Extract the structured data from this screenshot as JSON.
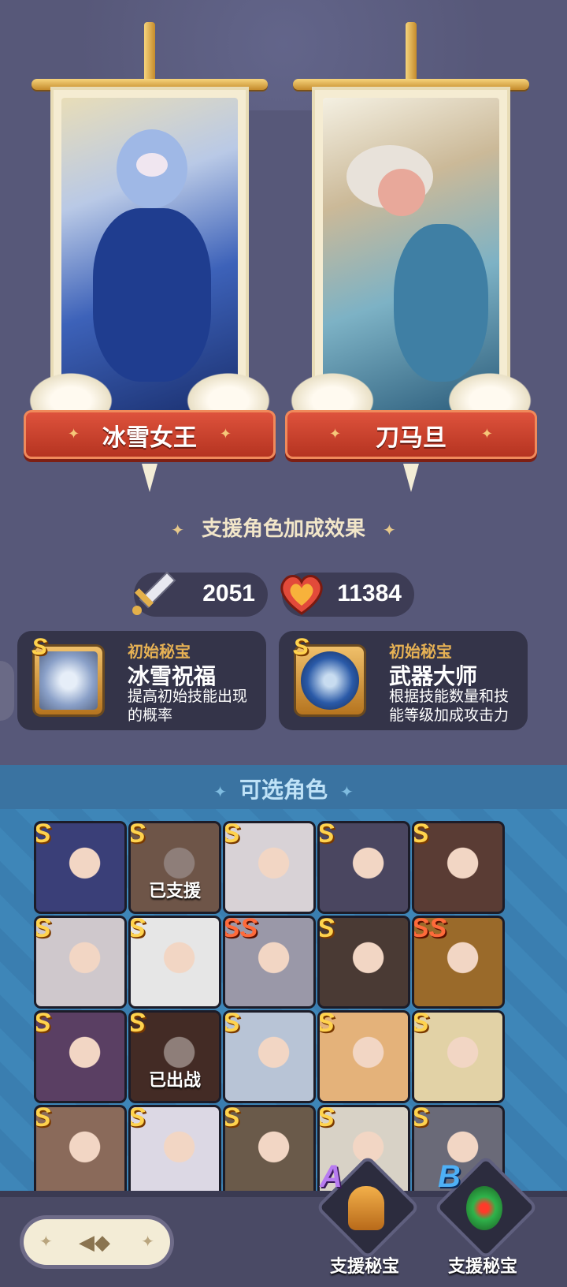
{
  "featured": [
    {
      "name": "冰雪女王",
      "theme": "ice"
    },
    {
      "name": "刀马旦",
      "theme": "opera"
    }
  ],
  "bonus": {
    "title": "支援角色加成效果",
    "attack": "2051",
    "hp": "11384"
  },
  "treasures": [
    {
      "grade": "S",
      "kind": "初始秘宝",
      "name": "冰雪祝福",
      "desc": "提高初始技能出现的概率"
    },
    {
      "grade": "S",
      "kind": "初始秘宝",
      "name": "武器大师",
      "desc": "根据技能数量和技能等级加成攻击力"
    }
  ],
  "selectable": {
    "title": "可选角色",
    "grid": [
      {
        "grade": "S",
        "status": "",
        "color": "#3a3f78"
      },
      {
        "grade": "S",
        "status": "已支援",
        "color": "#b88a6a"
      },
      {
        "grade": "S",
        "status": "",
        "color": "#d8d2d6"
      },
      {
        "grade": "S",
        "status": "",
        "color": "#4a4660"
      },
      {
        "grade": "S",
        "status": "",
        "color": "#5a3c34"
      },
      {
        "grade": "S",
        "status": "",
        "color": "#cfc8cc"
      },
      {
        "grade": "S",
        "status": "",
        "color": "#e6e6e6"
      },
      {
        "grade": "SS",
        "status": "",
        "color": "#9a98a8"
      },
      {
        "grade": "S",
        "status": "",
        "color": "#4a3a34"
      },
      {
        "grade": "SS",
        "status": "",
        "color": "#9a6a2a"
      },
      {
        "grade": "S",
        "status": "",
        "color": "#5a3f63"
      },
      {
        "grade": "S",
        "status": "已出战",
        "color": "#6b3f2a"
      },
      {
        "grade": "S",
        "status": "",
        "color": "#b8c4d6"
      },
      {
        "grade": "S",
        "status": "",
        "color": "#e4b27a"
      },
      {
        "grade": "S",
        "status": "",
        "color": "#e2d2a6"
      },
      {
        "grade": "S",
        "status": "",
        "color": "#8a6a5a"
      },
      {
        "grade": "S",
        "status": "",
        "color": "#dcd8e4"
      },
      {
        "grade": "S",
        "status": "",
        "color": "#6a5a4a"
      },
      {
        "grade": "S",
        "status": "",
        "color": "#d8d2c6"
      },
      {
        "grade": "S",
        "status": "",
        "color": "#6a6a78"
      }
    ]
  },
  "bottom": {
    "support_a": {
      "letter": "A",
      "label": "支援秘宝",
      "color": "#a96de0"
    },
    "support_b": {
      "letter": "B",
      "label": "支援秘宝",
      "color": "#4ea6f0"
    }
  }
}
